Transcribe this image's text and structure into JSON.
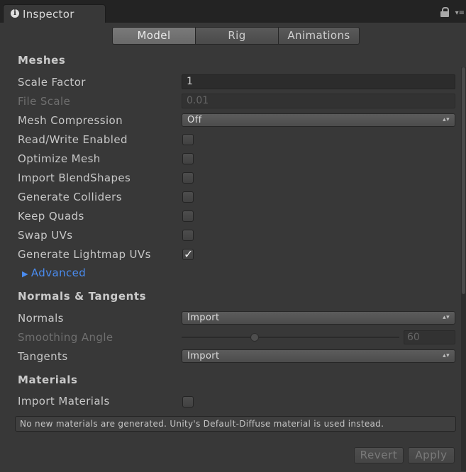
{
  "window": {
    "tab_title": "Inspector"
  },
  "toolbar": {
    "tabs": [
      {
        "label": "Model",
        "active": true
      },
      {
        "label": "Rig",
        "active": false
      },
      {
        "label": "Animations",
        "active": false
      }
    ]
  },
  "meshes": {
    "header": "Meshes",
    "scale_factor": {
      "label": "Scale Factor",
      "value": "1"
    },
    "file_scale": {
      "label": "File Scale",
      "value": "0.01"
    },
    "mesh_compression": {
      "label": "Mesh Compression",
      "value": "Off"
    },
    "checkboxes": [
      {
        "label": "Read/Write Enabled",
        "checked": false
      },
      {
        "label": "Optimize Mesh",
        "checked": false
      },
      {
        "label": "Import BlendShapes",
        "checked": false
      },
      {
        "label": "Generate Colliders",
        "checked": false
      },
      {
        "label": "Keep Quads",
        "checked": false
      },
      {
        "label": "Swap UVs",
        "checked": false
      },
      {
        "label": "Generate Lightmap UVs",
        "checked": true
      }
    ],
    "advanced": "Advanced"
  },
  "normals": {
    "header": "Normals & Tangents",
    "normals": {
      "label": "Normals",
      "value": "Import"
    },
    "smoothing_angle": {
      "label": "Smoothing Angle",
      "value": "60",
      "min": 0,
      "max": 180
    },
    "tangents": {
      "label": "Tangents",
      "value": "Import"
    }
  },
  "materials": {
    "header": "Materials",
    "import_materials": {
      "label": "Import Materials",
      "checked": false
    },
    "help": "No new materials are generated. Unity's Default-Diffuse material is used instead."
  },
  "footer": {
    "revert": "Revert",
    "apply": "Apply"
  },
  "colors": {
    "background": "#383838",
    "link": "#4a8cf0",
    "active_tab": "#7a7a7a"
  },
  "icons": {
    "info": "info-icon",
    "lock": "lock-icon",
    "menu": "menu-icon",
    "checkmark": "check-icon",
    "foldout": "triangle-right-icon"
  }
}
